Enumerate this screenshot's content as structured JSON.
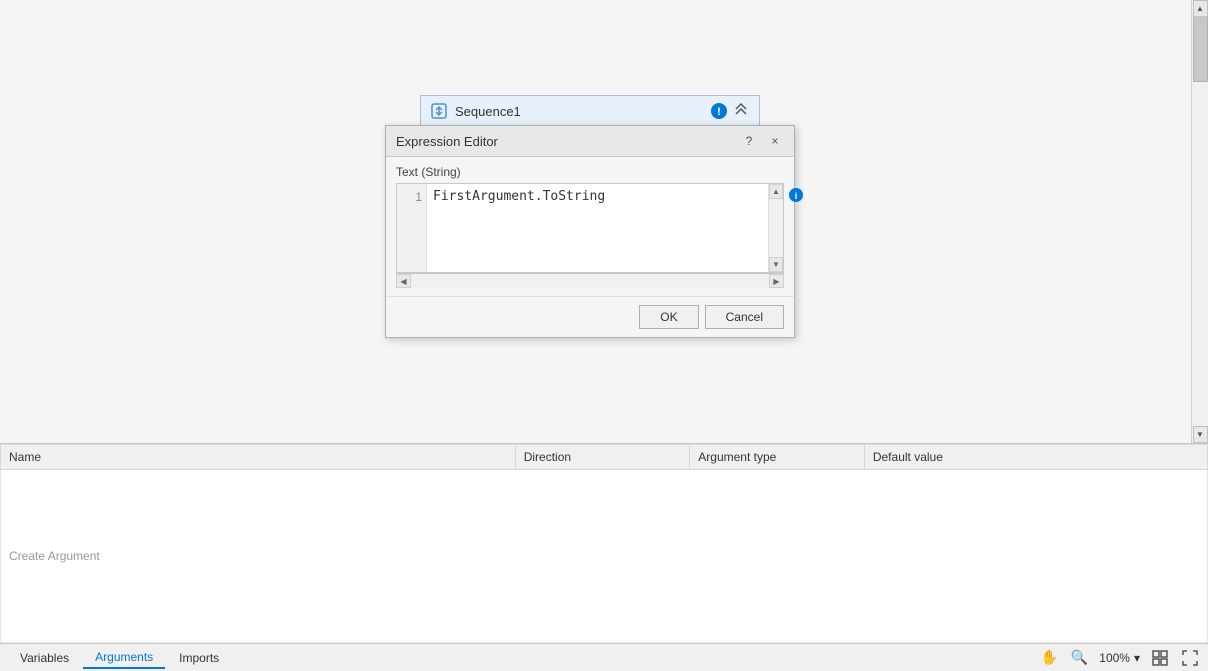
{
  "canvas": {
    "background": "#f5f5f5"
  },
  "sequence": {
    "title": "Sequence1",
    "icon_label": "sequence-icon"
  },
  "dialog": {
    "title": "Expression Editor",
    "help_label": "?",
    "close_label": "×",
    "field_label": "Text (String)",
    "line_number": "1",
    "expression_value": "FirstArgument.ToString",
    "ok_label": "OK",
    "cancel_label": "Cancel"
  },
  "arguments_table": {
    "columns": [
      "Name",
      "Direction",
      "Argument type",
      "Default value"
    ],
    "create_row_label": "Create Argument"
  },
  "bottom_bar": {
    "tabs": [
      {
        "label": "Variables",
        "active": false
      },
      {
        "label": "Arguments",
        "active": true
      },
      {
        "label": "Imports",
        "active": false
      }
    ],
    "zoom_label": "100%",
    "zoom_dropdown_icon": "▾"
  }
}
